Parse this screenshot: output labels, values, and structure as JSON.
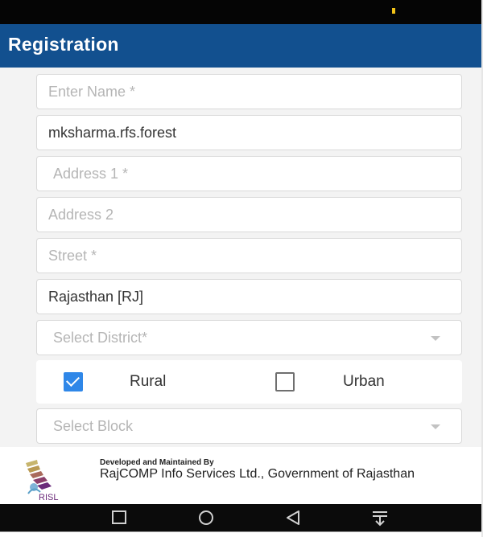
{
  "app": {
    "title": "Registration"
  },
  "form": {
    "name": {
      "placeholder": "Enter Name *"
    },
    "username": {
      "value": "mksharma.rfs.forest"
    },
    "address1": {
      "placeholder": "Address 1 *"
    },
    "address2": {
      "placeholder": "Address 2"
    },
    "street": {
      "placeholder": "Street *"
    },
    "state": {
      "value": "Rajasthan [RJ]"
    },
    "district": {
      "placeholder": "Select District*"
    },
    "area_type": {
      "rural": {
        "label": "Rural",
        "checked": true
      },
      "urban": {
        "label": "Urban",
        "checked": false
      }
    },
    "block": {
      "placeholder": "Select Block"
    }
  },
  "footer": {
    "caption": "Developed and Maintained By",
    "company": "RajCOMP Info Services Ltd., Government of Rajasthan",
    "logo_text": "RISL"
  },
  "nav": {
    "icons": [
      "square-icon",
      "circle-icon",
      "triangle-back-icon",
      "notification-shade-icon"
    ]
  },
  "colors": {
    "app_bar": "#12508f",
    "status_bar": "#050505",
    "checkbox_checked": "#2f87e8",
    "form_background": "#f3f3f3"
  }
}
